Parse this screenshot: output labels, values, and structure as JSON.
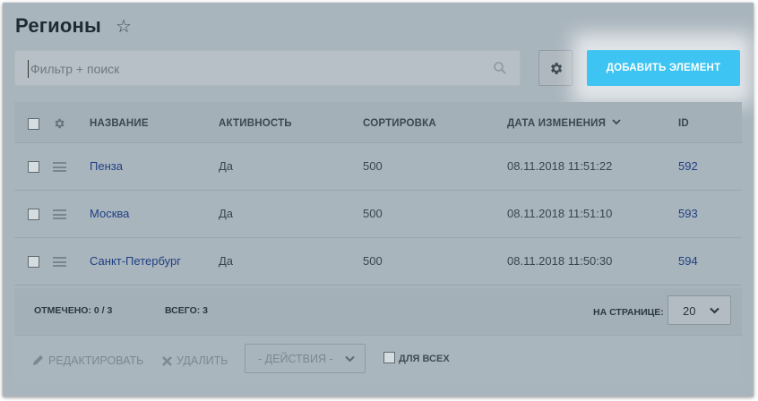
{
  "page": {
    "title": "Регионы",
    "favorite_icon": "star-icon"
  },
  "toolbar": {
    "filter_placeholder": "Фильтр + поиск",
    "filter_value": "",
    "settings_icon": "gear-icon",
    "add_label": "Добавить элемент",
    "accent_color": "#3dc4f2"
  },
  "grid": {
    "columns": [
      "Название",
      "Активность",
      "Сортировка",
      "Дата изменения",
      "ID"
    ],
    "sort_column": "Дата изменения",
    "rows": [
      {
        "name": "Пенза",
        "active": "Да",
        "sort": "500",
        "modified": "08.11.2018 11:51:22",
        "id": "592"
      },
      {
        "name": "Москва",
        "active": "Да",
        "sort": "500",
        "modified": "08.11.2018 11:51:10",
        "id": "593"
      },
      {
        "name": "Санкт-Петербург",
        "active": "Да",
        "sort": "500",
        "modified": "08.11.2018 11:50:30",
        "id": "594"
      }
    ]
  },
  "summary": {
    "selected_label": "Отмечено:",
    "selected_value": "0 / 3",
    "total_label": "Всего:",
    "total_value": "3",
    "per_page_label": "На странице:",
    "per_page_value": "20"
  },
  "actions": {
    "edit_label": "Редактировать",
    "delete_label": "Удалить",
    "actions_select": "- Действия -",
    "for_all_label": "Для всех"
  }
}
